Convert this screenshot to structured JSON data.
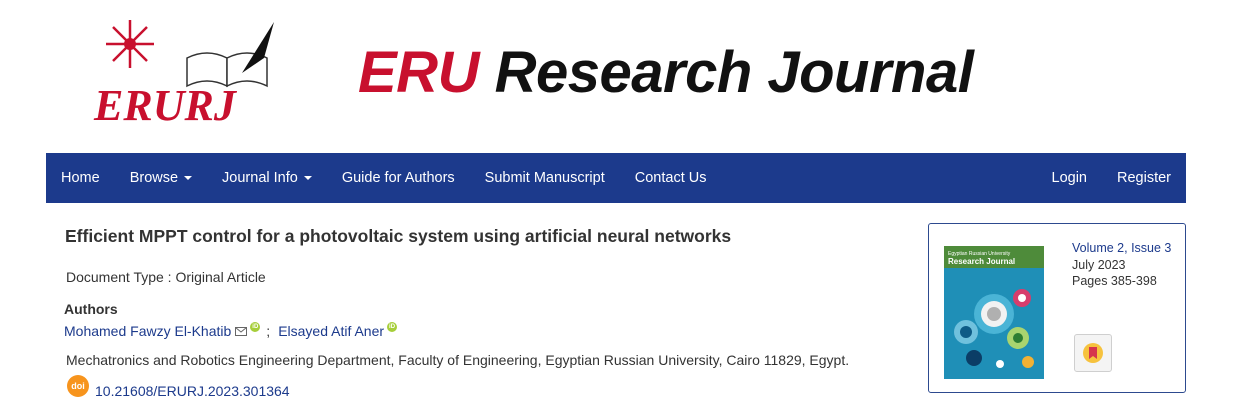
{
  "header": {
    "logo_text": "ERURJ",
    "title_highlight": "ERU",
    "title_rest": " Research Journal"
  },
  "nav": {
    "left": [
      {
        "label": "Home",
        "dropdown": false
      },
      {
        "label": "Browse",
        "dropdown": true
      },
      {
        "label": "Journal Info",
        "dropdown": true
      },
      {
        "label": "Guide for Authors",
        "dropdown": false
      },
      {
        "label": "Submit Manuscript",
        "dropdown": false
      },
      {
        "label": "Contact Us",
        "dropdown": false
      }
    ],
    "right": [
      {
        "label": "Login"
      },
      {
        "label": "Register"
      }
    ],
    "background": "#1c3a8c"
  },
  "article": {
    "title": "Efficient MPPT control for a photovoltaic system using artificial neural networks",
    "document_type": "Document Type : Original Article",
    "authors_heading": "Authors",
    "authors": [
      {
        "name": "Mohamed Fawzy El-Khatib",
        "has_email": true,
        "has_orcid": true
      },
      {
        "name": "Elsayed Atif Aner",
        "has_email": false,
        "has_orcid": true
      }
    ],
    "author_separator": ";",
    "affiliation": "Mechatronics and Robotics Engineering Department, Faculty of Engineering, Egyptian Russian University, Cairo 11829, Egypt.",
    "doi_badge": "doi",
    "doi": "10.21608/ERURJ.2023.301364"
  },
  "issue": {
    "volume": "Volume 2, Issue 3",
    "date": "July 2023",
    "pages": "Pages 385-398",
    "cover_title": "Research Journal",
    "cover_subtitle": "Egyptian Russian University"
  },
  "icons": {
    "email": "envelope-icon",
    "orcid": "orcid-icon",
    "doi": "doi-icon",
    "bookmark": "bookmark-icon",
    "dropdown": "caret-down-icon"
  },
  "colors": {
    "brand_red": "#c8102e",
    "link_blue": "#1c3a8c",
    "doi_orange": "#f7941d",
    "orcid_green": "#a6ce39"
  }
}
